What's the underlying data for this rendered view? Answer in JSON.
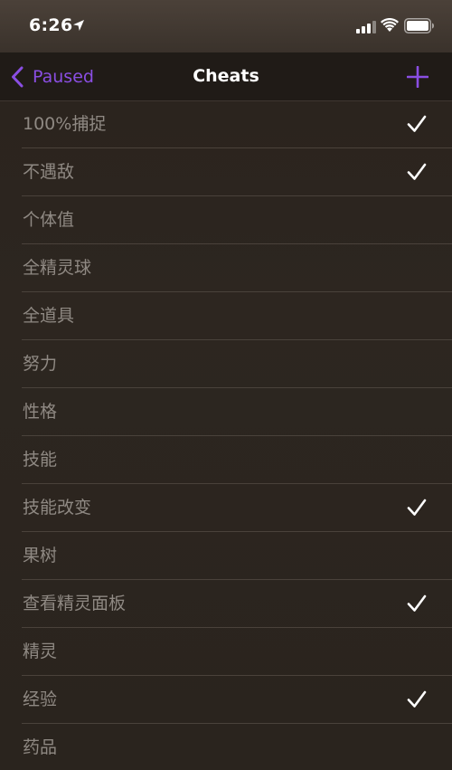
{
  "status_bar": {
    "time": "6:26",
    "icons": [
      "location-arrow-icon",
      "cellular-signal-icon",
      "wifi-icon",
      "battery-icon"
    ]
  },
  "nav": {
    "back_label": "Paused",
    "title": "Cheats",
    "add_icon": "plus-icon",
    "back_icon": "chevron-left-icon"
  },
  "colors": {
    "accent": "#8a4ee3",
    "row_text": "#8f8983",
    "checkmark": "#ffffff",
    "background": "#2b241e",
    "separator": "#4a423b"
  },
  "cheats": [
    {
      "label": "100%捕捉",
      "checked": true
    },
    {
      "label": "不遇敌",
      "checked": true
    },
    {
      "label": "个体值",
      "checked": false
    },
    {
      "label": "全精灵球",
      "checked": false
    },
    {
      "label": "全道具",
      "checked": false
    },
    {
      "label": "努力",
      "checked": false
    },
    {
      "label": "性格",
      "checked": false
    },
    {
      "label": "技能",
      "checked": false
    },
    {
      "label": "技能改变",
      "checked": true
    },
    {
      "label": "果树",
      "checked": false
    },
    {
      "label": "查看精灵面板",
      "checked": true
    },
    {
      "label": "精灵",
      "checked": false
    },
    {
      "label": "经验",
      "checked": true
    },
    {
      "label": "药品",
      "checked": false
    }
  ]
}
